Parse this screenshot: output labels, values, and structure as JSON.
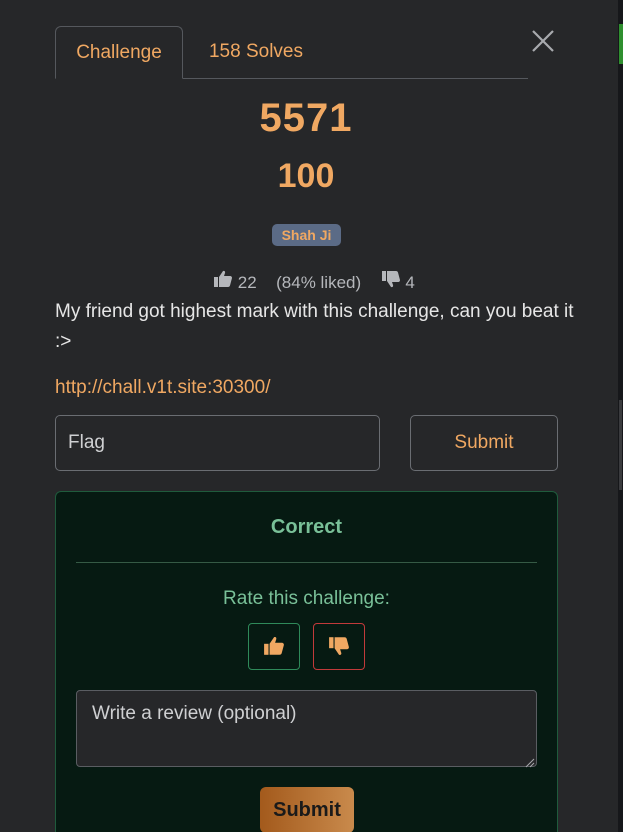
{
  "tabs": [
    {
      "label": "Challenge",
      "active": true
    },
    {
      "label": "158 Solves",
      "active": false
    }
  ],
  "challenge": {
    "name": "5571",
    "points": "100",
    "tag": "Shah Ji",
    "likes": "22",
    "liked_percent": "(84% liked)",
    "dislikes": "4",
    "description": "My friend got highest mark with this challenge, can you beat it :>",
    "link": "http://chall.v1t.site:30300/"
  },
  "flag_form": {
    "placeholder": "Flag",
    "submit_label": "Submit"
  },
  "result": {
    "status": "Correct",
    "rate_label": "Rate this challenge:",
    "review_placeholder": "Write a review (optional)",
    "review_submit_label": "Submit"
  },
  "icons": {
    "close": "close-icon",
    "like": "thumbs-up-icon",
    "dislike": "thumbs-down-icon"
  },
  "colors": {
    "accent": "#f0a862",
    "success": "#79c098",
    "danger": "#c23a3a",
    "background": "#262729"
  }
}
